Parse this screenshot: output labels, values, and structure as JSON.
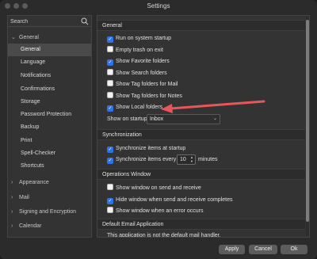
{
  "window": {
    "title": "Settings"
  },
  "search": {
    "placeholder": "Search"
  },
  "sidebar": {
    "groups": [
      {
        "label": "General",
        "expanded": true
      },
      {
        "label": "Appearance",
        "expanded": false
      },
      {
        "label": "Mail",
        "expanded": false
      },
      {
        "label": "Signing and Encryption",
        "expanded": false
      },
      {
        "label": "Calendar",
        "expanded": false
      }
    ],
    "items": [
      "General",
      "Language",
      "Notifications",
      "Confirmations",
      "Storage",
      "Password Protection",
      "Backup",
      "Print",
      "Spell-Checker",
      "Shortcuts"
    ],
    "selected": "General"
  },
  "main": {
    "general": {
      "title": "General",
      "options": [
        {
          "label": "Run on system startup",
          "checked": true
        },
        {
          "label": "Empty trash on exit",
          "checked": false
        },
        {
          "label": "Show Favorite folders",
          "checked": true
        },
        {
          "label": "Show Search folders",
          "checked": false
        },
        {
          "label": "Show Tag folders for Mail",
          "checked": false
        },
        {
          "label": "Show Tag folders for Notes",
          "checked": false
        },
        {
          "label": "Show Local folders",
          "checked": true
        }
      ],
      "startup_label": "Show on startup:",
      "startup_value": "Inbox"
    },
    "sync": {
      "title": "Synchronization",
      "startup_label": "Synchronize items at startup",
      "startup_checked": true,
      "every_label": "Synchronize items every",
      "every_checked": true,
      "every_value": "10",
      "every_unit": "minutes"
    },
    "ops": {
      "title": "Operations Window",
      "options": [
        {
          "label": "Show window on send and receive",
          "checked": false
        },
        {
          "label": "Hide window when send and receive completes",
          "checked": true
        },
        {
          "label": "Show window when an error occurs",
          "checked": false
        }
      ]
    },
    "default_app": {
      "title": "Default Email Application",
      "text": "This application is not the default mail handler."
    }
  },
  "footer": {
    "apply": "Apply",
    "cancel": "Cancel",
    "ok": "Ok"
  },
  "colors": {
    "accent": "#2f73e8",
    "arrow": "#e8565c"
  }
}
